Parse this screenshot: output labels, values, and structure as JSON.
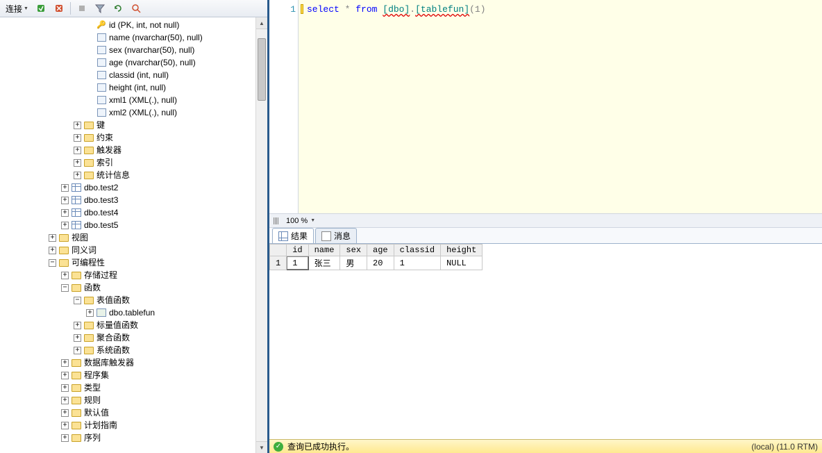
{
  "toolbar": {
    "connect": "连接"
  },
  "tree": {
    "columns": [
      "id (PK, int, not null)",
      "name (nvarchar(50), null)",
      "sex (nvarchar(50), null)",
      "age (nvarchar(50), null)",
      "classid (int, null)",
      "height (int, null)",
      "xml1 (XML(.), null)",
      "xml2 (XML(.), null)"
    ],
    "sub_folders": [
      "键",
      "约束",
      "触发器",
      "索引",
      "统计信息"
    ],
    "tables": [
      "dbo.test2",
      "dbo.test3",
      "dbo.test4",
      "dbo.test5"
    ],
    "views": "视图",
    "synonyms": "同义词",
    "programmability": "可编程性",
    "stored_procs": "存储过程",
    "functions": "函数",
    "table_valued_fn": "表值函数",
    "tablefun": "dbo.tablefun",
    "scalar_fn": "标量值函数",
    "aggregate_fn": "聚合函数",
    "system_fn": "系统函数",
    "db_triggers": "数据库触发器",
    "assemblies": "程序集",
    "types": "类型",
    "rules": "规则",
    "defaults": "默认值",
    "plan_guides": "计划指南",
    "sequences": "序列"
  },
  "editor": {
    "line_num": "1",
    "kw_select": "select",
    "star": "*",
    "kw_from": "from",
    "obj_schema": "[dbo]",
    "dot": ".",
    "obj_name": "[tablefun]",
    "args": "(1)"
  },
  "zoom": {
    "value": "100 %"
  },
  "tabs": {
    "results": "结果",
    "messages": "消息"
  },
  "grid": {
    "headers": [
      "id",
      "name",
      "sex",
      "age",
      "classid",
      "height"
    ],
    "rownum": "1",
    "row": [
      "1",
      "张三",
      "男",
      "20",
      "1",
      "NULL"
    ]
  },
  "status": {
    "message": "查询已成功执行。",
    "server": "(local) (11.0 RTM)"
  }
}
